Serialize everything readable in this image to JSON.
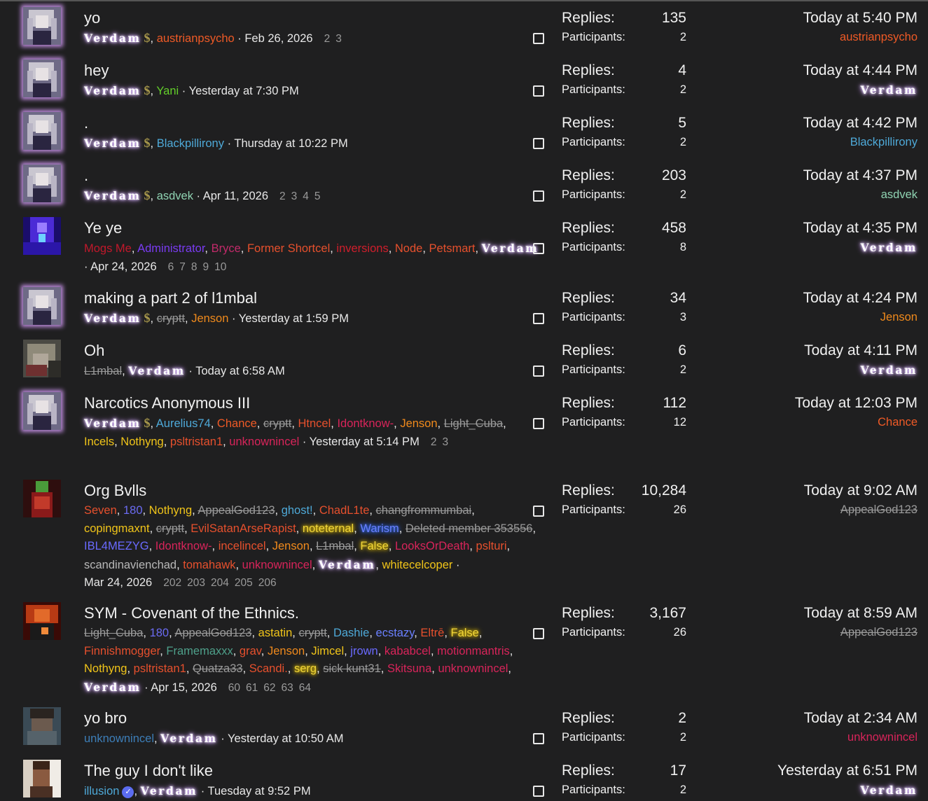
{
  "colors": {
    "background": "#1f1f20",
    "text": "#ececec",
    "muted": "#9a9a9a"
  },
  "labels": {
    "replies": "Replies:",
    "participants": "Participants:"
  },
  "threads": [
    {
      "title": "yo",
      "avatar": "anime-grey-hair",
      "glow": true,
      "starters": [
        {
          "name": "Verdam",
          "style": "elite",
          "badge": "$"
        },
        {
          "name": "austrianpsycho",
          "color": "#ef5a26"
        }
      ],
      "date": "Feb 26, 2026",
      "pages": [
        "2",
        "3"
      ],
      "replies": "135",
      "participants": "2",
      "last_time": "Today at 5:40 PM",
      "last_user": {
        "name": "austrianpsycho",
        "color": "#ef5a26"
      }
    },
    {
      "title": "hey",
      "avatar": "anime-grey-hair",
      "glow": true,
      "starters": [
        {
          "name": "Verdam",
          "style": "elite",
          "badge": "$"
        },
        {
          "name": "Yani",
          "color": "#63cf2a"
        }
      ],
      "date": "Yesterday at 7:30 PM",
      "pages": [],
      "replies": "4",
      "participants": "2",
      "last_time": "Today at 4:44 PM",
      "last_user": {
        "name": "Verdam",
        "style": "elite"
      }
    },
    {
      "title": ".",
      "avatar": "anime-grey-hair",
      "glow": true,
      "starters": [
        {
          "name": "Verdam",
          "style": "elite",
          "badge": "$"
        },
        {
          "name": "Blackpillirony",
          "color": "#4ea9d8"
        }
      ],
      "date": "Thursday at 10:22 PM",
      "pages": [],
      "replies": "5",
      "participants": "2",
      "last_time": "Today at 4:42 PM",
      "last_user": {
        "name": "Blackpillirony",
        "color": "#4ea9d8"
      }
    },
    {
      "title": ".",
      "avatar": "anime-grey-hair",
      "glow": true,
      "starters": [
        {
          "name": "Verdam",
          "style": "elite",
          "badge": "$"
        },
        {
          "name": "asdvek",
          "color": "#8fd3b2"
        }
      ],
      "date": "Apr 11, 2026",
      "pages": [
        "2",
        "3",
        "4",
        "5"
      ],
      "replies": "203",
      "participants": "2",
      "last_time": "Today at 4:37 PM",
      "last_user": {
        "name": "asdvek",
        "color": "#8fd3b2"
      }
    },
    {
      "title": "Ye ye",
      "avatar": "purple-figure",
      "glow": false,
      "starters": [
        {
          "name": "Mogs Me",
          "color": "#c2182b"
        },
        {
          "name": "Administrator",
          "color": "#7a3bf2"
        },
        {
          "name": "Bryce",
          "color": "#c22a6a"
        },
        {
          "name": "Former Shortcel",
          "color": "#e6502d"
        },
        {
          "name": "inversions",
          "color": "#d01e2c"
        },
        {
          "name": "Node",
          "color": "#e6502d"
        },
        {
          "name": "Petsmart",
          "color": "#e6502d"
        },
        {
          "name": "Verdam",
          "style": "elite"
        }
      ],
      "date": "Apr 24, 2026",
      "pages": [
        "6",
        "7",
        "8",
        "9",
        "10"
      ],
      "replies": "458",
      "participants": "8",
      "last_time": "Today at 4:35 PM",
      "last_user": {
        "name": "Verdam",
        "style": "elite"
      }
    },
    {
      "title": "making a part 2 of l1mbal",
      "avatar": "anime-grey-hair",
      "glow": true,
      "starters": [
        {
          "name": "Verdam",
          "style": "elite",
          "badge": "$"
        },
        {
          "name": "cryptt",
          "color": "#9a9a9a",
          "strike": true
        },
        {
          "name": "Jenson",
          "color": "#f08a1c"
        }
      ],
      "date": "Yesterday at 1:59 PM",
      "pages": [],
      "replies": "34",
      "participants": "3",
      "last_time": "Today at 4:24 PM",
      "last_user": {
        "name": "Jenson",
        "color": "#f08a1c"
      }
    },
    {
      "title": "Oh",
      "avatar": "grey-creature",
      "glow": false,
      "starters": [
        {
          "name": "L1mbal",
          "color": "#9a9a9a",
          "strike": true
        },
        {
          "name": "Verdam",
          "style": "elite"
        }
      ],
      "date": "Today at 6:58 AM",
      "pages": [],
      "replies": "6",
      "participants": "2",
      "last_time": "Today at 4:11 PM",
      "last_user": {
        "name": "Verdam",
        "style": "elite"
      }
    },
    {
      "title": "Narcotics Anonymous III",
      "avatar": "anime-grey-hair",
      "glow": true,
      "starters": [
        {
          "name": "Verdam",
          "style": "elite",
          "badge": "$"
        },
        {
          "name": "Aurelius74",
          "color": "#4ea9d8"
        },
        {
          "name": "Chance",
          "color": "#ef5a26"
        },
        {
          "name": "cryptt",
          "color": "#9a9a9a",
          "strike": true
        },
        {
          "name": "Htncel",
          "color": "#e6502d"
        },
        {
          "name": "Idontknow-",
          "color": "#d8245a"
        },
        {
          "name": "Jenson",
          "color": "#f08a1c"
        },
        {
          "name": "Light_Cuba",
          "color": "#9a9a9a",
          "strike": true
        },
        {
          "name": "Incels",
          "color": "#f0c419"
        },
        {
          "name": "Nothyng",
          "color": "#f0c419"
        },
        {
          "name": "psltristan1",
          "color": "#e6502d"
        },
        {
          "name": "unknownincel",
          "color": "#d8245a"
        }
      ],
      "date": "Yesterday at 5:14 PM",
      "pages": [
        "2",
        "3"
      ],
      "replies": "112",
      "participants": "12",
      "last_time": "Today at 12:03 PM",
      "last_user": {
        "name": "Chance",
        "color": "#ef5a26"
      }
    },
    {
      "title": "Org Bvlls",
      "avatar": "red-figure",
      "glow": false,
      "starters": [
        {
          "name": "Seven",
          "color": "#e6502d"
        },
        {
          "name": "180",
          "color": "#6b6bf2"
        },
        {
          "name": "Nothyng",
          "color": "#f0c419"
        },
        {
          "name": "AppealGod123",
          "color": "#9a9a9a",
          "strike": true
        },
        {
          "name": "ghost!",
          "color": "#4ea9d8"
        },
        {
          "name": "ChadL1te",
          "color": "#e6502d"
        },
        {
          "name": "changfrommumbai",
          "color": "#9a9a9a",
          "strike": true
        },
        {
          "name": "copingmaxnt",
          "color": "#f0c419"
        },
        {
          "name": "cryptt",
          "color": "#9a9a9a",
          "strike": true
        },
        {
          "name": "EvilSatanArseRapist",
          "color": "#e6502d"
        },
        {
          "name": "noteternal",
          "color": "#f0d53a",
          "glow": "gold"
        },
        {
          "name": "Warism",
          "color": "#6a80ff",
          "glow": "blue"
        },
        {
          "name": "Deleted member 353556",
          "color": "#9a9a9a",
          "strike": true
        },
        {
          "name": "IBL4MEZYG",
          "color": "#6a6aff"
        },
        {
          "name": "Idontknow-",
          "color": "#d8245a"
        },
        {
          "name": "incelincel",
          "color": "#e6502d"
        },
        {
          "name": "Jenson",
          "color": "#f08a1c"
        },
        {
          "name": "L1mbal",
          "color": "#9a9a9a",
          "strike": true
        },
        {
          "name": "False",
          "color": "#f0d53a",
          "glow": "gold"
        },
        {
          "name": "LooksOrDeath",
          "color": "#d8245a"
        },
        {
          "name": "pslturi",
          "color": "#e6502d"
        },
        {
          "name": "scandinavienchad",
          "color": "#b8b8b8"
        },
        {
          "name": "tomahawk",
          "color": "#e6502d"
        },
        {
          "name": "unknownincel",
          "color": "#d8245a"
        },
        {
          "name": "Verdam",
          "style": "elite"
        },
        {
          "name": "whitecelcoper",
          "color": "#f0c419"
        }
      ],
      "date": "Mar 24, 2026",
      "pages": [
        "202",
        "203",
        "204",
        "205",
        "206"
      ],
      "replies": "10,284",
      "participants": "26",
      "last_time": "Today at 9:02 AM",
      "last_user": {
        "name": "AppealGod123",
        "color": "#9a9a9a",
        "strike": true
      }
    },
    {
      "title": "SYM - Covenant of the Ethnics.",
      "avatar": "red-warrior",
      "glow": false,
      "starters": [
        {
          "name": "Light_Cuba",
          "color": "#9a9a9a",
          "strike": true
        },
        {
          "name": "180",
          "color": "#6b6bf2"
        },
        {
          "name": "AppealGod123",
          "color": "#9a9a9a",
          "strike": true
        },
        {
          "name": "astatin",
          "color": "#f0c419"
        },
        {
          "name": "cryptt",
          "color": "#9a9a9a",
          "strike": true
        },
        {
          "name": "Dashie",
          "color": "#4ea9d8"
        },
        {
          "name": "ecstazy",
          "color": "#6a80ff"
        },
        {
          "name": "Eltrē",
          "color": "#e6502d"
        },
        {
          "name": "False",
          "color": "#f0d53a",
          "glow": "gold"
        },
        {
          "name": "Finnishmogger",
          "color": "#e6502d"
        },
        {
          "name": "Framemaxxx",
          "color": "#4ea08a"
        },
        {
          "name": "grav",
          "color": "#e6502d"
        },
        {
          "name": "Jenson",
          "color": "#f08a1c"
        },
        {
          "name": "Jimcel",
          "color": "#f0c419"
        },
        {
          "name": "jrown",
          "color": "#6a6aff"
        },
        {
          "name": "kababcel",
          "color": "#d8245a"
        },
        {
          "name": "motionmantris",
          "color": "#d8245a"
        },
        {
          "name": "Nothyng",
          "color": "#f0c419"
        },
        {
          "name": "psltristan1",
          "color": "#e6502d"
        },
        {
          "name": "Quatza33",
          "color": "#9a9a9a",
          "strike": true
        },
        {
          "name": "Scandi.",
          "color": "#e6502d"
        },
        {
          "name": "serg",
          "color": "#f0d53a",
          "glow": "gold"
        },
        {
          "name": "sick kunt31",
          "color": "#9a9a9a",
          "strike": true
        },
        {
          "name": "Skitsuna",
          "color": "#d8245a"
        },
        {
          "name": "unknownincel",
          "color": "#d8245a"
        },
        {
          "name": "Verdam",
          "style": "elite"
        }
      ],
      "date": "Apr 15, 2026",
      "pages": [
        "60",
        "61",
        "62",
        "63",
        "64"
      ],
      "replies": "3,167",
      "participants": "26",
      "last_time": "Today at 8:59 AM",
      "last_user": {
        "name": "AppealGod123",
        "color": "#9a9a9a",
        "strike": true
      }
    },
    {
      "title": "yo bro",
      "avatar": "dark-portrait",
      "glow": false,
      "starters": [
        {
          "name": "unknownincel",
          "color": "#3d7eb8"
        },
        {
          "name": "Verdam",
          "style": "elite"
        }
      ],
      "date": "Yesterday at 10:50 AM",
      "pages": [],
      "replies": "2",
      "participants": "2",
      "last_time": "Today at 2:34 AM",
      "last_user": {
        "name": "unknownincel",
        "color": "#d8245a"
      }
    },
    {
      "title": "The guy I don't like",
      "avatar": "man-portrait",
      "glow": false,
      "starters": [
        {
          "name": "illusion",
          "color": "#4ea9d8",
          "verified": true
        },
        {
          "name": "Verdam",
          "style": "elite"
        }
      ],
      "date": "Tuesday at 9:52 PM",
      "pages": [],
      "replies": "17",
      "participants": "2",
      "last_time": "Yesterday at 6:51 PM",
      "last_user": {
        "name": "Verdam",
        "style": "elite"
      }
    }
  ]
}
